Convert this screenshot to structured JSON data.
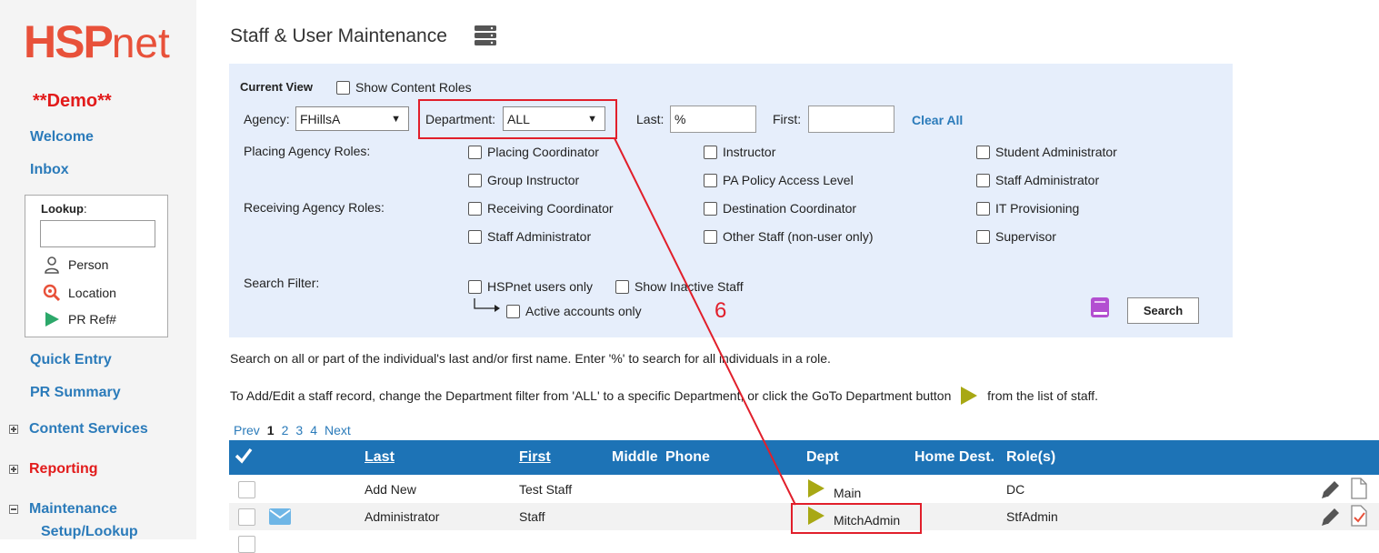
{
  "brand": {
    "logo_main": "HSP",
    "logo_suffix": "net",
    "demo_label": "**Demo**"
  },
  "sidebar": {
    "welcome": "Welcome",
    "inbox": "Inbox",
    "lookup": {
      "label": "Lookup",
      "colon": ":",
      "input_value": "",
      "person": "Person",
      "location": "Location",
      "pr_ref": "PR Ref#"
    },
    "quick_entry": "Quick Entry",
    "pr_summary": "PR Summary",
    "content_services": "Content Services",
    "reporting": "Reporting",
    "maintenance": "Maintenance",
    "setup_lookup": "Setup/Lookup"
  },
  "page": {
    "title": "Staff & User Maintenance"
  },
  "filters": {
    "current_view": "Current View",
    "show_content_roles": "Show Content Roles",
    "agency_label": "Agency:",
    "agency_value": "FHillsA",
    "department_label": "Department:",
    "department_value": "ALL",
    "last_label": "Last:",
    "last_value": "%",
    "first_label": "First:",
    "first_value": "",
    "clear_all": "Clear All",
    "placing_roles_label": "Placing Agency Roles:",
    "receiving_roles_label": "Receiving Agency Roles:",
    "roles": {
      "r1": [
        "Placing Coordinator",
        "Instructor",
        "Student Administrator"
      ],
      "r2": [
        "Group Instructor",
        "PA Policy Access Level",
        "Staff Administrator"
      ],
      "r3": [
        "Receiving Coordinator",
        "Destination Coordinator",
        "IT Provisioning"
      ],
      "r4": [
        "Staff Administrator",
        "Other Staff (non-user only)",
        "Supervisor"
      ]
    },
    "search_filter_label": "Search Filter:",
    "hspnet_users_only": "HSPnet users only",
    "show_inactive_staff": "Show Inactive Staff",
    "active_accounts_only": "Active accounts only",
    "search_button": "Search"
  },
  "info": {
    "line1": "Search on all or part of the individual's last and/or first name. Enter '%' to search for all individuals in a role.",
    "line2_pre": "To Add/Edit a staff record, change the Department filter from 'ALL' to a specific Department, or click the GoTo Department button",
    "line2_post": "from the list of staff."
  },
  "pager": {
    "prev": "Prev",
    "pages": [
      "1",
      "2",
      "3",
      "4"
    ],
    "current": "1",
    "next": "Next"
  },
  "table": {
    "headers": {
      "last": "Last",
      "first": "First",
      "middle": "Middle",
      "phone": "Phone",
      "dept": "Dept",
      "home_dest": "Home Dest.",
      "roles": "Role(s)"
    },
    "rows": [
      {
        "last": "Add New",
        "first": "Test Staff",
        "dept": "Main",
        "roles": "DC"
      },
      {
        "last": "Administrator",
        "first": "Staff",
        "dept": "MitchAdmin",
        "roles": "StfAdmin"
      }
    ]
  },
  "annotation": {
    "step_number": "6"
  },
  "colors": {
    "brand_orange": "#e8513a",
    "link_blue": "#2b7bba",
    "header_blue": "#1d73b6",
    "annotation_red": "#e11f2b",
    "goto_olive": "#a8a814"
  }
}
